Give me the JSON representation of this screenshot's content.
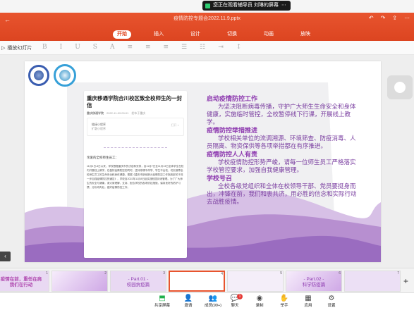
{
  "banner": {
    "text": "您正在观看辅导员 刘琳的屏幕"
  },
  "window": {
    "title": "疫情防控专题会2022.11.9.pptx"
  },
  "ribbon": {
    "tabs": [
      "开始",
      "插入",
      "设计",
      "切换",
      "动画",
      "放映"
    ],
    "active_tab": 0
  },
  "toolbar": {
    "play_label": "播放幻灯片"
  },
  "slide": {
    "letter": {
      "title": "重庆移通学院合川校区致全校师生的一封信",
      "author": "重庆移通学院",
      "date": "2022-11-09 00:01",
      "extra": "发布于重庆",
      "card_line1": "链接小程序",
      "card_line2": "扩散小程序",
      "card_arrow": "打开 >",
      "greeting": "亲爱的全校师生员工：",
      "body": "11月4日-8日以来，学校根据重庆市的决定和安排，自11月7日至11月13日全体学生在校内开展线上教学，在做好疫情防控的同时，坚持停课不停学、学生不出校，切实保障全校师生员工的生命安全和身体健康。根据《重庆市新冠肺炎疫情防控工作指挥部关于进一步加强疫情防控的通告》，学校自2022年11月8日起实施校园封闭管理。为了广大师生的安全与健康，请大家理解、支持、配合学校的各项防控措施，保持良好的防护习惯，分析研判后，做好疫情防控工作。"
    },
    "sections": [
      {
        "heading": "启动疫情防控工作",
        "text": "为坚决阻断病毒传播，守护广大师生生命安全和身体健康，实施临时管控，全校暂停线下行课，开展线上教学。"
      },
      {
        "heading": "疫情防控举措推进",
        "text": "学校相关单位的流调溯源、环境筛查、防疫消毒、人员隔离、物资保供等各项举措都在有序推进。"
      },
      {
        "heading": "疫情防控人人有责",
        "text": "学校疫情防控形势严峻，请每一位师生员工严格落实学校管控要求，加强自我健康管理。"
      },
      {
        "heading": "学校号召",
        "text": "全校各级党组织和全体在校领导干部、党员要挺身而出，冲锋在前，我们和衷共济，用必胜的信念和实际行动去战胜疫情。"
      }
    ]
  },
  "thumbnails": [
    {
      "num": "1",
      "label": "疫情在前，重任在肩\n我们在行动"
    },
    {
      "num": "2",
      "label": ""
    },
    {
      "num": "3",
      "label": "- Part.01 -\n校园抗疫篇"
    },
    {
      "num": "4",
      "label": ""
    },
    {
      "num": "5",
      "label": ""
    },
    {
      "num": "6",
      "label": "- Part.02 -\n科学防疫篇"
    },
    {
      "num": "7",
      "label": ""
    }
  ],
  "meeting_bar": [
    {
      "label": "共享屏幕",
      "icon": "share-screen-icon"
    },
    {
      "label": "邀请",
      "icon": "invite-icon"
    },
    {
      "label": "成员(99+)",
      "icon": "members-icon"
    },
    {
      "label": "聊天",
      "icon": "chat-icon"
    },
    {
      "label": "录制",
      "icon": "record-icon"
    },
    {
      "label": "举手",
      "icon": "raise-hand-icon"
    },
    {
      "label": "应用",
      "icon": "apps-icon"
    },
    {
      "label": "设置",
      "icon": "settings-icon"
    }
  ],
  "chat_badge": "1",
  "colors": {
    "accent": "#e8542e",
    "heading": "#8e3bb0",
    "body": "#7a3ea0",
    "wave": "#b78fd0"
  }
}
